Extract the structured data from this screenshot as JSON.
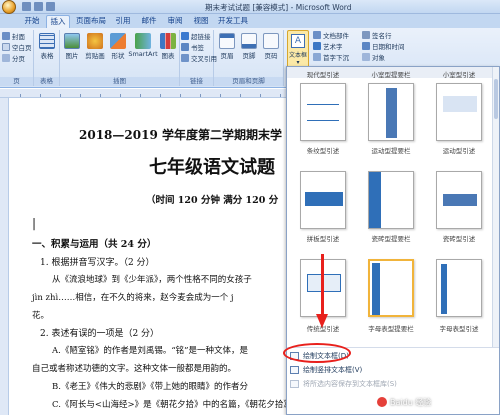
{
  "window": {
    "title": "期末考试试题 [兼容模式] - Microsoft Word"
  },
  "tabs": [
    "开始",
    "插入",
    "页面布局",
    "引用",
    "邮件",
    "审阅",
    "视图",
    "开发工具"
  ],
  "active_tab": "插入",
  "ribbon": {
    "pages": {
      "items": [
        "封面",
        "空白页",
        "分页"
      ],
      "label": "页"
    },
    "table": {
      "button": "表格",
      "label": "表格"
    },
    "illustrations": {
      "buttons": [
        "图片",
        "剪贴画",
        "形状",
        "SmartArt",
        "图表"
      ],
      "label": "插图"
    },
    "links": {
      "items": [
        "超链接",
        "书签",
        "交叉引用"
      ],
      "label": "链接"
    },
    "header_footer": {
      "buttons": [
        "页眉",
        "页脚",
        "页码"
      ],
      "label": "页眉和页脚"
    },
    "text": {
      "textbox": "文本框",
      "items": [
        "文档部件",
        "艺术字",
        "首字下沉"
      ],
      "right_items": [
        "签名行",
        "日期和时间",
        "对象"
      ]
    }
  },
  "document": {
    "title": "2018—2019 学年度第二学期期末学",
    "subtitle": "七年级语文试题",
    "time_info": "（时间 120 分钟    满分 120 分",
    "section1": "一、积累与运用（共 24 分）",
    "q1": "1. 根据拼音写汉字。（2 分）",
    "q1_text1": "从《流浪地球》到《少年派》，两个性格不同的女孩子",
    "q1_text2": "jìn zhì……相信，在不久的将来，赵今麦会成为一个 j",
    "q1_text3": "花。",
    "q2": "2. 表述有误的一项是（2 分）",
    "q2_a1": "A.《陋室铭》的作者是刘禹锡。“铭”是一种文体，是",
    "q2_a2": "自己或者称述功德的文字。这种文体一般都是用韵的。",
    "q2_b": "B.《老王》《伟大的悲剧》《带上她的眼睛》的作者分",
    "q2_c": "C.《阿长与<山海经>》是《朝花夕拾》中的名篇，《朝花夕拾》是鲁迅回忆童年、"
  },
  "gallery": {
    "captions": [
      "现代型引述",
      "小室型提要栏",
      "小室型引述",
      "条纹型引述",
      "运动型提要栏",
      "运动型引述",
      "拼板型引述",
      "瓷砖型提要栏",
      "瓷砖型引述",
      "传统型引述",
      "字母表型提要栏",
      "字母表型引述"
    ],
    "selected_index": 10,
    "menu": [
      "绘制文本框(D)",
      "绘制竖排文本框(V)",
      "将所选内容保存到文本框库(S)"
    ]
  },
  "watermark": "Baidu 经验",
  "colors": {
    "accent": "#2f6fb8",
    "annotation": "#e8201c",
    "selection": "#f1b43b"
  }
}
